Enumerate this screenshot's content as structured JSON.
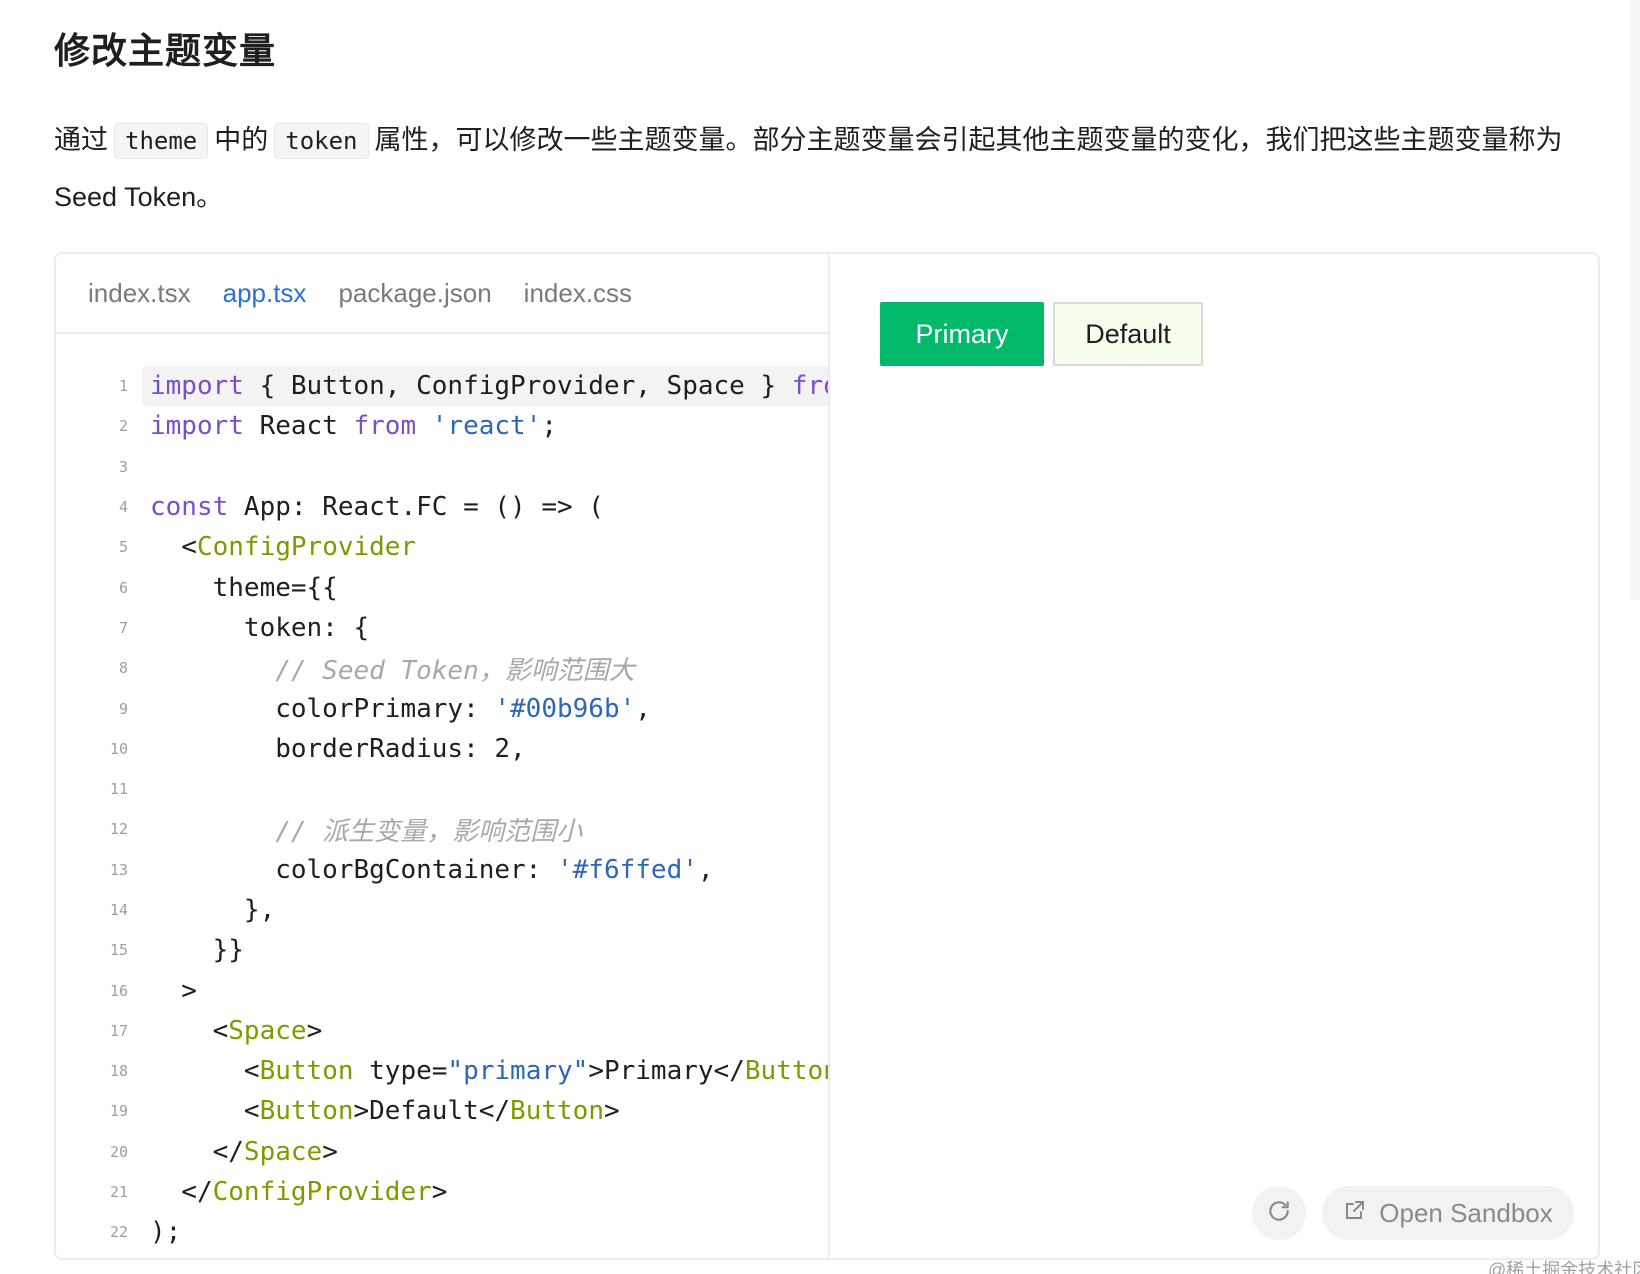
{
  "page": {
    "title": "修改主题变量",
    "intro": {
      "seg1": "通过",
      "code1": "theme",
      "seg2": "中的",
      "code2": "token",
      "seg3": "属性，可以修改一些主题变量。部分主题变量会引起其他主题变量的变化，我们把这些主题变量称为 Seed Token。"
    }
  },
  "demo": {
    "tabs": [
      {
        "label": "index.tsx",
        "active": false
      },
      {
        "label": "app.tsx",
        "active": true
      },
      {
        "label": "package.json",
        "active": false
      },
      {
        "label": "index.css",
        "active": false
      }
    ],
    "code_lines": [
      {
        "no": "1",
        "highlight": true,
        "tokens": [
          [
            "kw",
            "import"
          ],
          [
            "p",
            " { Button, ConfigProvider, Space } "
          ],
          [
            "kw",
            "from"
          ]
        ]
      },
      {
        "no": "2",
        "tokens": [
          [
            "kw",
            "import"
          ],
          [
            "p",
            " React "
          ],
          [
            "kw",
            "from"
          ],
          [
            "p",
            " "
          ],
          [
            "str",
            "'react'"
          ],
          [
            "p",
            ";"
          ]
        ]
      },
      {
        "no": "3",
        "tokens": []
      },
      {
        "no": "4",
        "tokens": [
          [
            "kw",
            "const"
          ],
          [
            "p",
            " App: React.FC = () => ("
          ]
        ]
      },
      {
        "no": "5",
        "tokens": [
          [
            "p",
            "  <"
          ],
          [
            "tag",
            "ConfigProvider"
          ]
        ]
      },
      {
        "no": "6",
        "tokens": [
          [
            "p",
            "    theme={{"
          ]
        ]
      },
      {
        "no": "7",
        "tokens": [
          [
            "p",
            "      token: {"
          ]
        ]
      },
      {
        "no": "8",
        "tokens": [
          [
            "com",
            "        // Seed Token，影响范围大"
          ]
        ]
      },
      {
        "no": "9",
        "tokens": [
          [
            "p",
            "        colorPrimary: "
          ],
          [
            "str",
            "'#00b96b'"
          ],
          [
            "p",
            ","
          ]
        ]
      },
      {
        "no": "10",
        "tokens": [
          [
            "p",
            "        borderRadius: 2,"
          ]
        ]
      },
      {
        "no": "11",
        "tokens": []
      },
      {
        "no": "12",
        "tokens": [
          [
            "com",
            "        // 派生变量，影响范围小"
          ]
        ]
      },
      {
        "no": "13",
        "tokens": [
          [
            "p",
            "        colorBgContainer: "
          ],
          [
            "str",
            "'#f6ffed'"
          ],
          [
            "p",
            ","
          ]
        ]
      },
      {
        "no": "14",
        "tokens": [
          [
            "p",
            "      },"
          ]
        ]
      },
      {
        "no": "15",
        "tokens": [
          [
            "p",
            "    }}"
          ]
        ]
      },
      {
        "no": "16",
        "tokens": [
          [
            "p",
            "  >"
          ]
        ]
      },
      {
        "no": "17",
        "tokens": [
          [
            "p",
            "    <"
          ],
          [
            "tag",
            "Space"
          ],
          [
            "p",
            ">"
          ]
        ]
      },
      {
        "no": "18",
        "tokens": [
          [
            "p",
            "      <"
          ],
          [
            "tag",
            "Button"
          ],
          [
            "p",
            " type="
          ],
          [
            "str",
            "\"primary\""
          ],
          [
            "p",
            ">Primary</"
          ],
          [
            "tag",
            "Button"
          ],
          [
            "p",
            ">"
          ]
        ]
      },
      {
        "no": "19",
        "tokens": [
          [
            "p",
            "      <"
          ],
          [
            "tag",
            "Button"
          ],
          [
            "p",
            ">Default</"
          ],
          [
            "tag",
            "Button"
          ],
          [
            "p",
            ">"
          ]
        ]
      },
      {
        "no": "20",
        "tokens": [
          [
            "p",
            "    </"
          ],
          [
            "tag",
            "Space"
          ],
          [
            "p",
            ">"
          ]
        ]
      },
      {
        "no": "21",
        "tokens": [
          [
            "p",
            "  </"
          ],
          [
            "tag",
            "ConfigProvider"
          ],
          [
            "p",
            ">"
          ]
        ]
      },
      {
        "no": "22",
        "tokens": [
          [
            "p",
            ");"
          ]
        ]
      }
    ],
    "preview": {
      "primary_label": "Primary",
      "default_label": "Default",
      "primary_color": "#00b96b",
      "default_bg": "#f6ffed"
    },
    "actions": {
      "reload_icon": "reload-icon",
      "sandbox_icon": "external-link-icon",
      "sandbox_label": "Open Sandbox"
    }
  },
  "watermark": "@稀土掘金技术社区"
}
